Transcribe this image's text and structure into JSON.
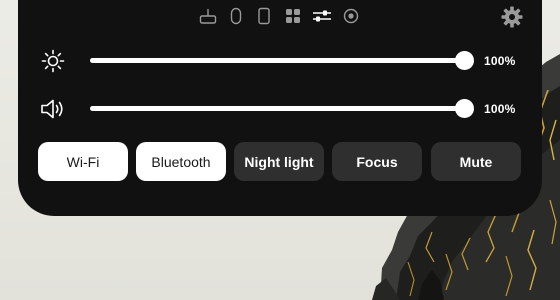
{
  "quick_settings": {
    "tabs": [
      {
        "icon": "usb-icon"
      },
      {
        "icon": "mouse-icon"
      },
      {
        "icon": "phone-icon"
      },
      {
        "icon": "apps-grid-icon"
      },
      {
        "icon": "sliders-icon",
        "active": true
      },
      {
        "icon": "record-icon"
      }
    ],
    "settings_icon": "gear-icon",
    "brightness": {
      "icon": "sun-icon",
      "level_percent": 100,
      "value_label": "100%"
    },
    "volume": {
      "icon": "speaker-icon",
      "level_percent": 100,
      "value_label": "100%"
    },
    "toggles": [
      {
        "label": "Wi-Fi",
        "state": "on"
      },
      {
        "label": "Bluetooth",
        "state": "on"
      },
      {
        "label": "Night light",
        "state": "off"
      },
      {
        "label": "Focus",
        "state": "off"
      },
      {
        "label": "Mute",
        "state": "off"
      }
    ]
  },
  "colors": {
    "panel_background": "#111111",
    "toggle_on": "#ffffff",
    "toggle_off": "#2f2f2f",
    "slider_track": "#4a4a4a"
  }
}
